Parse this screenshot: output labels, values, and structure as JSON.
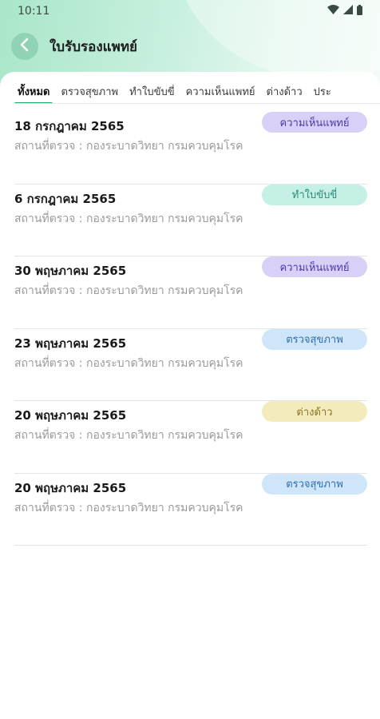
{
  "status_bar": {
    "time": "10:11"
  },
  "header": {
    "title": "ใบรับรองแพทย์"
  },
  "tabs": [
    {
      "label": "ทั้งหมด",
      "active": true
    },
    {
      "label": "ตรวจสุขภาพ",
      "active": false
    },
    {
      "label": "ทำใบขับขี่",
      "active": false
    },
    {
      "label": "ความเห็นแพทย์",
      "active": false
    },
    {
      "label": "ต่างด้าว",
      "active": false
    },
    {
      "label": "ประ",
      "active": false
    }
  ],
  "records": [
    {
      "date": "18 กรกฎาคม 2565",
      "place": "สถานที่ตรวจ : กองระบาดวิทยา กรมควบคุมโรค",
      "badge": "ความเห็นแพทย์",
      "badge_type": "opinion"
    },
    {
      "date": "6 กรกฎาคม 2565",
      "place": "สถานที่ตรวจ : กองระบาดวิทยา กรมควบคุมโรค",
      "badge": "ทำใบขับขี่",
      "badge_type": "license"
    },
    {
      "date": "30 พฤษภาคม 2565",
      "place": "สถานที่ตรวจ : กองระบาดวิทยา กรมควบคุมโรค",
      "badge": "ความเห็นแพทย์",
      "badge_type": "opinion"
    },
    {
      "date": "23 พฤษภาคม 2565",
      "place": "สถานที่ตรวจ : กองระบาดวิทยา กรมควบคุมโรค",
      "badge": "ตรวจสุขภาพ",
      "badge_type": "checkup"
    },
    {
      "date": "20 พฤษภาคม 2565",
      "place": "สถานที่ตรวจ : กองระบาดวิทยา กรมควบคุมโรค",
      "badge": "ต่างด้าว",
      "badge_type": "foreign"
    },
    {
      "date": "20 พฤษภาคม 2565",
      "place": "สถานที่ตรวจ : กองระบาดวิทยา กรมควบคุมโรค",
      "badge": "ตรวจสุขภาพ",
      "badge_type": "checkup"
    }
  ],
  "colors": {
    "accent": "#23a96a",
    "header_gradient_start": "#a9e6c9",
    "badge_opinion": "#d9d0f7",
    "badge_license": "#c4f0e6",
    "badge_checkup": "#cfe6fa",
    "badge_foreign": "#f4ebbd"
  },
  "icons": [
    "wifi-icon",
    "signal-icon",
    "battery-icon",
    "back-arrow-icon"
  ]
}
